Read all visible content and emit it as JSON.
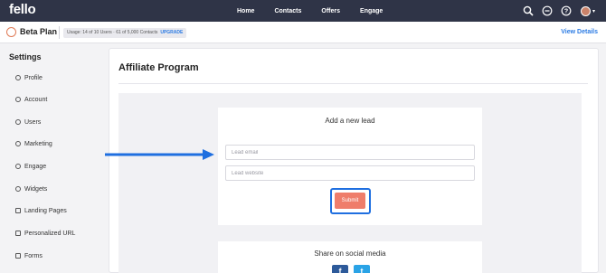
{
  "brand": {
    "logo": "fello"
  },
  "nav": {
    "links": [
      "Home",
      "Contacts",
      "Offers",
      "Engage"
    ]
  },
  "plan": {
    "title": "Beta Plan",
    "usage_text": "Usage: 14 of 10 Users · 61 of 5,000 Contacts",
    "upgrade_label": "UPGRADE",
    "view_details": "View Details"
  },
  "sidebar": {
    "title": "Settings",
    "items": [
      {
        "label": "Profile",
        "icon": "user-circle-icon"
      },
      {
        "label": "Account",
        "icon": "globe-icon"
      },
      {
        "label": "Users",
        "icon": "users-icon"
      },
      {
        "label": "Marketing",
        "icon": "tag-icon"
      },
      {
        "label": "Engage",
        "icon": "target-icon"
      },
      {
        "label": "Widgets",
        "icon": "widget-icon"
      },
      {
        "label": "Landing Pages",
        "icon": "page-icon"
      },
      {
        "label": "Personalized URL",
        "icon": "grid-icon"
      },
      {
        "label": "Forms",
        "icon": "list-icon"
      }
    ]
  },
  "main": {
    "title": "Affiliate Program",
    "lead_form": {
      "title": "Add a new lead",
      "email_placeholder": "Lead email",
      "website_placeholder": "Lead website",
      "submit_label": "Submit"
    },
    "share": {
      "title": "Share on social media",
      "facebook_glyph": "f",
      "twitter_glyph": "t"
    }
  },
  "colors": {
    "nav_bg": "#2f3447",
    "accent": "#2b7be4",
    "submit": "#ef7d6b",
    "highlight": "#1f6fe0"
  }
}
